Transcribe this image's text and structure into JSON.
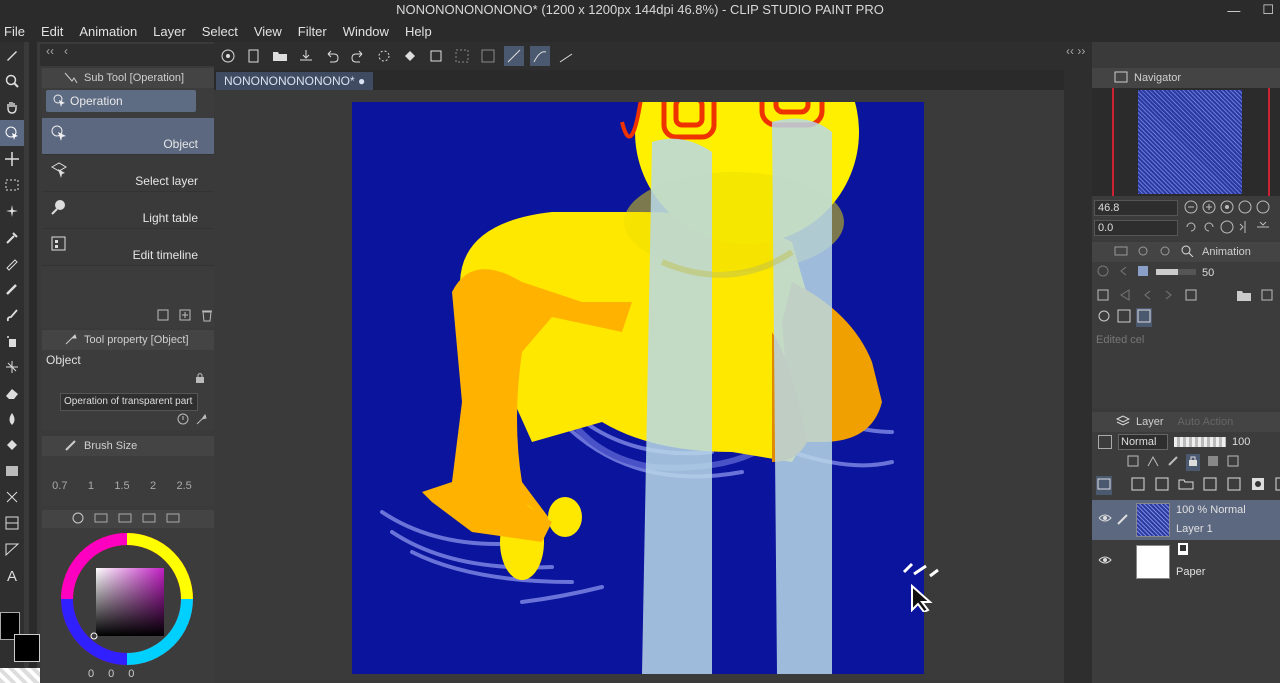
{
  "app": {
    "title": "NONONONONONONO* (1200 x 1200px 144dpi 46.8%)  - CLIP STUDIO PAINT PRO"
  },
  "window_controls": {
    "minimize": "—",
    "maximize": "☐"
  },
  "menu": [
    "File",
    "Edit",
    "Animation",
    "Layer",
    "Select",
    "View",
    "Filter",
    "Window",
    "Help"
  ],
  "sub_tool": {
    "header": "Sub Tool [Operation]",
    "group": "Operation",
    "items": [
      "Object",
      "Select layer",
      "Light table",
      "Edit timeline"
    ]
  },
  "tool_property": {
    "header": "Tool property [Object]",
    "name": "Object",
    "dropdown": "Operation of transparent part"
  },
  "brush_size": {
    "header": "Brush Size",
    "values": [
      "0.7",
      "1",
      "1.5",
      "2",
      "2.5"
    ]
  },
  "color": {
    "r": "0",
    "g": "0",
    "b": "0",
    "accent": "#5b6a82"
  },
  "document": {
    "tab": "NONONONONONONO*"
  },
  "navigator": {
    "header": "Navigator",
    "zoom": "46.8",
    "rotation": "0.0"
  },
  "animation": {
    "header": "Animation",
    "frame": "50",
    "edited_cel": "Edited cel"
  },
  "layer": {
    "header": "Layer",
    "auto_action": "Auto Action",
    "blend_mode": "Normal",
    "opacity": "100",
    "layers": [
      {
        "line1": "100 % Normal",
        "line2": "Layer 1"
      },
      {
        "line1": "",
        "line2": "Paper"
      }
    ]
  }
}
